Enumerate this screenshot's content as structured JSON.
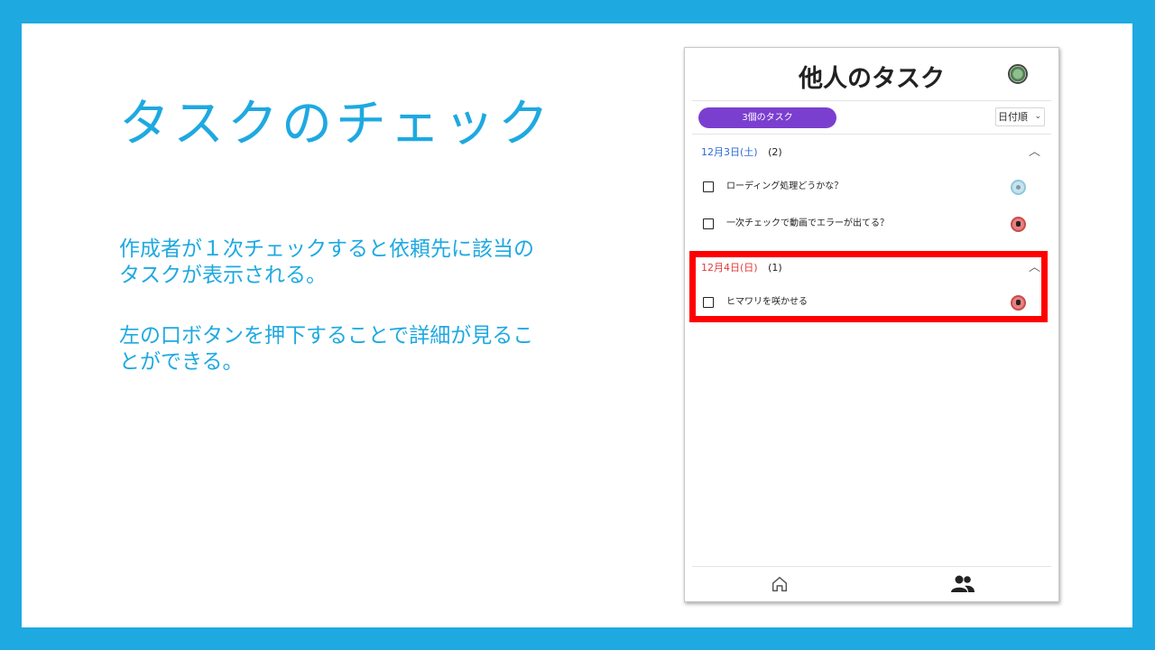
{
  "slide": {
    "title": "タスクのチェック",
    "description_1": "作成者が１次チェックすると依頼先に該当のタスクが表示される。",
    "description_2": "左の口ボタンを押下することで詳細が見ることができる。"
  },
  "app": {
    "title": "他人のタスク",
    "task_count_label": "3個のタスク",
    "sort_label": "日付順",
    "groups": [
      {
        "date": "12月3日(土)",
        "count": "(2)",
        "tasks": [
          {
            "text": "ローディング処理どうかな？",
            "assignee_color": "#8ec7db"
          },
          {
            "text": "一次チェックで動画でエラーが出てる？",
            "assignee_color": "#c94b4b"
          }
        ]
      },
      {
        "date": "12月4日(日)",
        "count": "(1)",
        "tasks": [
          {
            "text": "ヒマワリを咲かせる",
            "assignee_color": "#c94b4b"
          }
        ]
      }
    ]
  },
  "colors": {
    "accent": "#1ea9e1",
    "pill": "#7b3fd0",
    "highlight": "#ff0000",
    "date_blue": "#2d6ad6",
    "date_red": "#e23a3a"
  },
  "icons": [
    "avatar-icon",
    "chevron-down-icon",
    "chevron-up-icon",
    "checkbox-icon",
    "home-icon",
    "people-icon"
  ]
}
